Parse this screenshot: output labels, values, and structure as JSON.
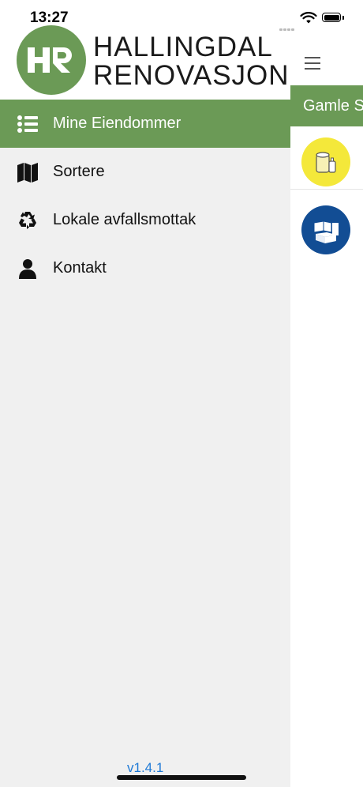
{
  "status_bar": {
    "time": "13:27"
  },
  "brand": {
    "line1": "HALLINGDAL",
    "line2": "RENOVASJON",
    "logo_text": "HR"
  },
  "nav": {
    "items": [
      {
        "label": "Mine Eiendommer",
        "icon": "list-icon",
        "active": true
      },
      {
        "label": "Sortere",
        "icon": "map-icon",
        "active": false
      },
      {
        "label": "Lokale avfallsmottak",
        "icon": "recycle-icon",
        "active": false
      },
      {
        "label": "Kontakt",
        "icon": "person-icon",
        "active": false
      }
    ]
  },
  "version": "v1.4.1",
  "background_view": {
    "tab_label": "Gamle S"
  },
  "colors": {
    "brand_green": "#6b9a56",
    "yellow_bin": "#f4e83a",
    "blue_bin": "#124d94",
    "link_blue": "#1f7ad6",
    "drawer_bg": "#f0f0f0"
  }
}
